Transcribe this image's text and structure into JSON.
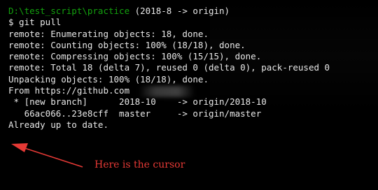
{
  "terminal": {
    "prompt_path": "D:\\test_script\\practice",
    "prompt_branch": " (2018-8 -> origin)",
    "command": "$ git pull",
    "lines": [
      "remote: Enumerating objects: 18, done.",
      "remote: Counting objects: 100% (18/18), done.",
      "remote: Compressing objects: 100% (15/15), done.",
      "remote: Total 18 (delta 7), reused 0 (delta 0), pack-reused 0",
      "Unpacking objects: 100% (18/18), done.",
      "From https://github.com"
    ],
    "branch_lines": [
      " * [new branch]      2018-10    -> origin/2018-10",
      "   66ac066..23e8cff  master     -> origin/master"
    ],
    "final_line": "Already up to date."
  },
  "annotation": {
    "text": "Here is the cursor",
    "color": "#e53935"
  }
}
